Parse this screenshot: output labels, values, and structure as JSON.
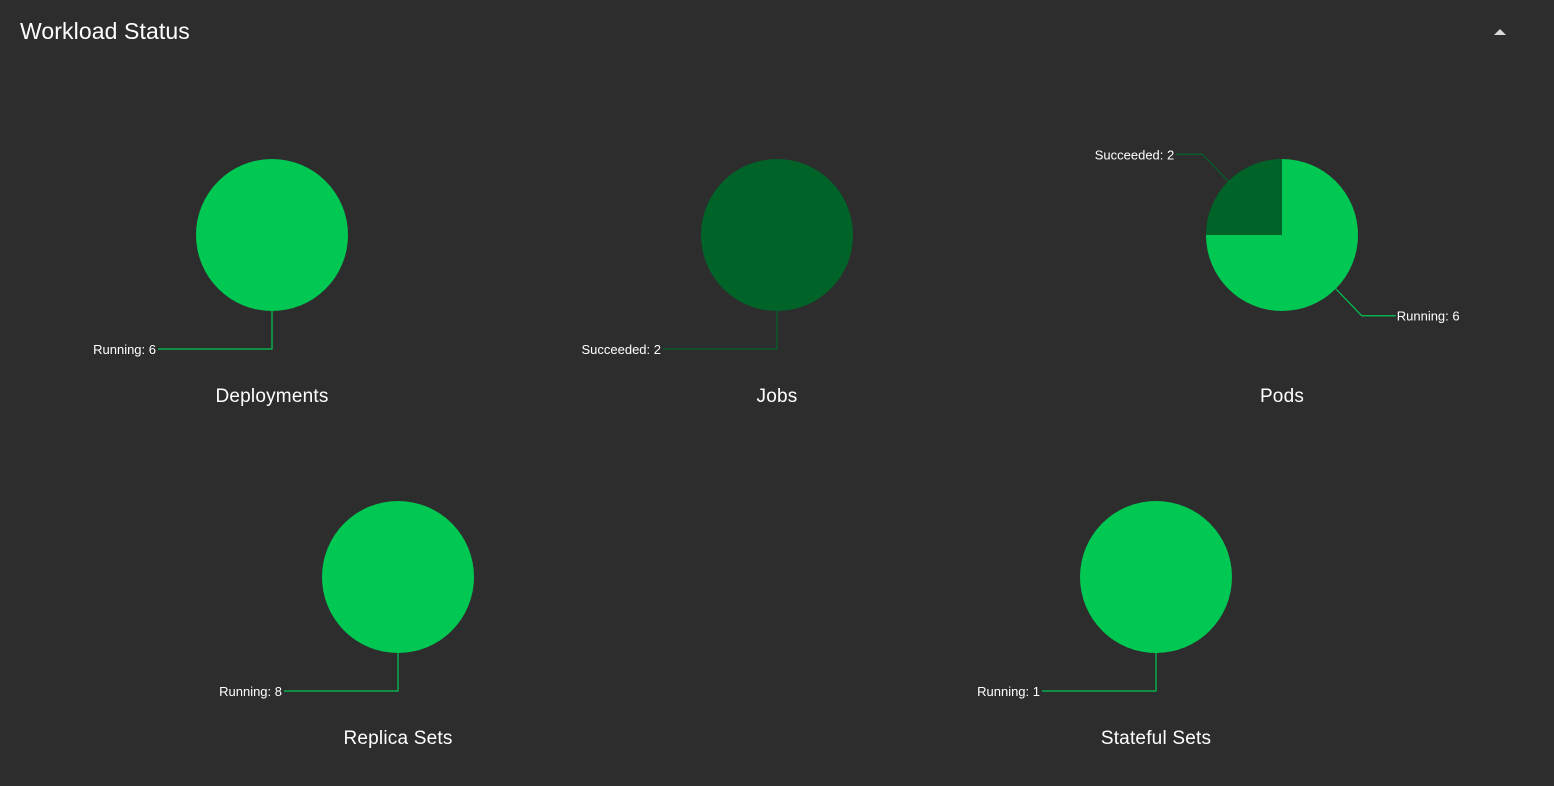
{
  "header": {
    "title": "Workload Status",
    "collapse_icon": "triangle-up-icon"
  },
  "colors": {
    "background": "#2d2d2d",
    "running": "#00c853",
    "succeeded": "#006429",
    "leader": "#00c853",
    "leader_dark": "#006429"
  },
  "chart_data": [
    {
      "type": "pie",
      "title": "Deployments",
      "slices": [
        {
          "label": "Running: 6",
          "status": "Running",
          "value": 6
        }
      ]
    },
    {
      "type": "pie",
      "title": "Jobs",
      "slices": [
        {
          "label": "Succeeded: 2",
          "status": "Succeeded",
          "value": 2
        }
      ]
    },
    {
      "type": "pie",
      "title": "Pods",
      "slices": [
        {
          "label": "Running: 6",
          "status": "Running",
          "value": 6
        },
        {
          "label": "Succeeded: 2",
          "status": "Succeeded",
          "value": 2
        }
      ]
    },
    {
      "type": "pie",
      "title": "Replica Sets",
      "slices": [
        {
          "label": "Running: 8",
          "status": "Running",
          "value": 8
        }
      ]
    },
    {
      "type": "pie",
      "title": "Stateful Sets",
      "slices": [
        {
          "label": "Running: 1",
          "status": "Running",
          "value": 1
        }
      ]
    }
  ]
}
